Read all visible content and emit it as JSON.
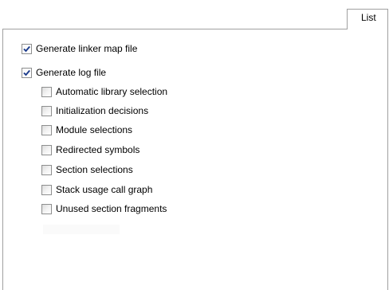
{
  "tabs": [
    {
      "label": "List"
    }
  ],
  "options": {
    "linker_map": {
      "label": "Generate linker map file",
      "checked": true
    },
    "log_file": {
      "label": "Generate log file",
      "checked": true
    },
    "log_items": [
      {
        "label": "Automatic library selection",
        "checked": false
      },
      {
        "label": "Initialization decisions",
        "checked": false
      },
      {
        "label": "Module selections",
        "checked": false
      },
      {
        "label": "Redirected symbols",
        "checked": false
      },
      {
        "label": "Section selections",
        "checked": false
      },
      {
        "label": "Stack usage call graph",
        "checked": false
      },
      {
        "label": "Unused section fragments",
        "checked": false
      }
    ]
  },
  "colors": {
    "checkmark": "#1a3a8c",
    "border": "#a0a0a0"
  }
}
